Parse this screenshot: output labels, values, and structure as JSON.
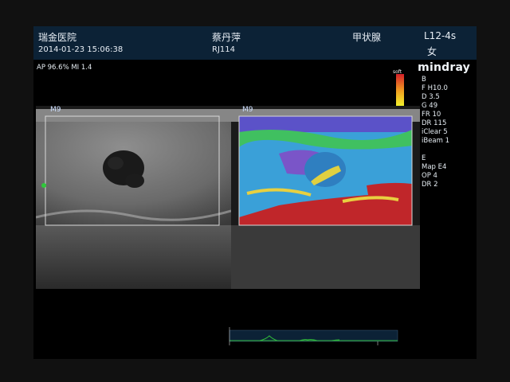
{
  "header": {
    "hospital": "瑞金医院",
    "datetime": "2014-01-23 15:06:38",
    "patient_name": "蔡丹萍",
    "patient_id": "RJ114",
    "exam_type": "甲状腺",
    "probe": "L12-4s",
    "gender": "女"
  },
  "acoustic": {
    "readout": "AP 96.6%  MI 1.4"
  },
  "brand": {
    "name": "mindray"
  },
  "colorbar": {
    "label": "soft"
  },
  "panels": {
    "left_label": "M9",
    "right_label": "M9"
  },
  "params": {
    "group1_marker": "B",
    "group1": [
      "F H10.0",
      "D 3.5",
      "G 49",
      "FR 10",
      "DR 115",
      "iClear 5",
      "iBeam 1"
    ],
    "group2_marker": "E",
    "group2": [
      "Map E4",
      "OP 4",
      "DR 2"
    ]
  },
  "colors": {
    "header_bg": "#0c2236",
    "roi_box": "#d8d8d8",
    "soft_color": "#c0262a",
    "waveform": "#2fb83a"
  }
}
